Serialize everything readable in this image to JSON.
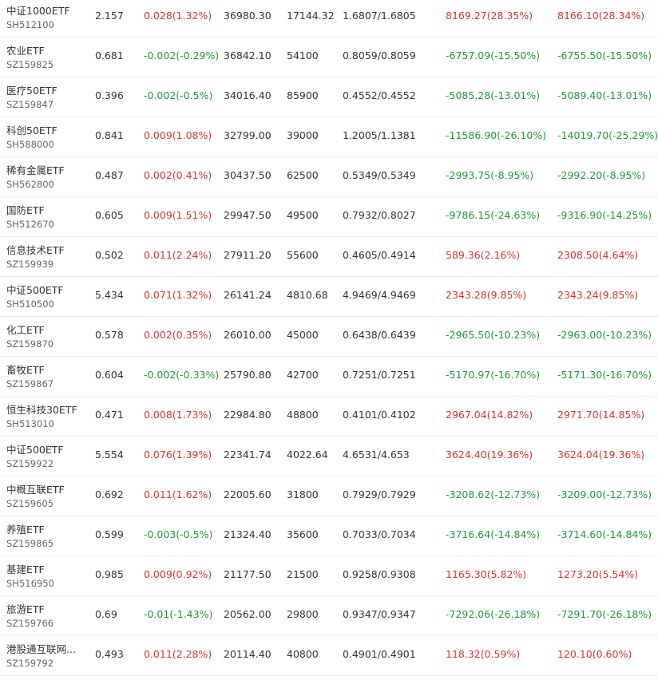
{
  "colors": {
    "up": "#e0312f",
    "down": "#1a9a3a",
    "text": "#333333",
    "subtext": "#666666",
    "divider": "#ececec"
  },
  "rows": [
    {
      "name": "中证1000ETF",
      "code": "SH512100",
      "price": "2.157",
      "change": "0.028(1.32%)",
      "change_dir": "up",
      "amount": "36980.30",
      "volume": "17144.32",
      "bid_ask": "1.6807/1.6805",
      "pl1": "8169.27(28.35%)",
      "pl1_dir": "up",
      "pl2": "8166.10(28.34%)",
      "pl2_dir": "up"
    },
    {
      "name": "农业ETF",
      "code": "SZ159825",
      "price": "0.681",
      "change": "-0.002(-0.29%)",
      "change_dir": "down",
      "amount": "36842.10",
      "volume": "54100",
      "bid_ask": "0.8059/0.8059",
      "pl1": "-6757.09(-15.50%)",
      "pl1_dir": "down",
      "pl2": "-6755.50(-15.50%)",
      "pl2_dir": "down"
    },
    {
      "name": "医疗50ETF",
      "code": "SZ159847",
      "price": "0.396",
      "change": "-0.002(-0.5%)",
      "change_dir": "down",
      "amount": "34016.40",
      "volume": "85900",
      "bid_ask": "0.4552/0.4552",
      "pl1": "-5085.28(-13.01%)",
      "pl1_dir": "down",
      "pl2": "-5089.40(-13.01%)",
      "pl2_dir": "down"
    },
    {
      "name": "科创50ETF",
      "code": "SH588000",
      "price": "0.841",
      "change": "0.009(1.08%)",
      "change_dir": "up",
      "amount": "32799.00",
      "volume": "39000",
      "bid_ask": "1.2005/1.1381",
      "pl1": "-11586.90(-26.10%)",
      "pl1_dir": "down",
      "pl2": "-14019.70(-25.29%)",
      "pl2_dir": "down"
    },
    {
      "name": "稀有金属ETF",
      "code": "SH562800",
      "price": "0.487",
      "change": "0.002(0.41%)",
      "change_dir": "up",
      "amount": "30437.50",
      "volume": "62500",
      "bid_ask": "0.5349/0.5349",
      "pl1": "-2993.75(-8.95%)",
      "pl1_dir": "down",
      "pl2": "-2992.20(-8.95%)",
      "pl2_dir": "down"
    },
    {
      "name": "国防ETF",
      "code": "SH512670",
      "price": "0.605",
      "change": "0.009(1.51%)",
      "change_dir": "up",
      "amount": "29947.50",
      "volume": "49500",
      "bid_ask": "0.7932/0.8027",
      "pl1": "-9786.15(-24.63%)",
      "pl1_dir": "down",
      "pl2": "-9316.90(-14.25%)",
      "pl2_dir": "down"
    },
    {
      "name": "信息技术ETF",
      "code": "SZ159939",
      "price": "0.502",
      "change": "0.011(2.24%)",
      "change_dir": "up",
      "amount": "27911.20",
      "volume": "55600",
      "bid_ask": "0.4605/0.4914",
      "pl1": "589.36(2.16%)",
      "pl1_dir": "up",
      "pl2": "2308.50(4.64%)",
      "pl2_dir": "up"
    },
    {
      "name": "中证500ETF",
      "code": "SH510500",
      "price": "5.434",
      "change": "0.071(1.32%)",
      "change_dir": "up",
      "amount": "26141.24",
      "volume": "4810.68",
      "bid_ask": "4.9469/4.9469",
      "pl1": "2343.28(9.85%)",
      "pl1_dir": "up",
      "pl2": "2343.24(9.85%)",
      "pl2_dir": "up"
    },
    {
      "name": "化工ETF",
      "code": "SZ159870",
      "price": "0.578",
      "change": "0.002(0.35%)",
      "change_dir": "up",
      "amount": "26010.00",
      "volume": "45000",
      "bid_ask": "0.6438/0.6439",
      "pl1": "-2965.50(-10.23%)",
      "pl1_dir": "down",
      "pl2": "-2963.00(-10.23%)",
      "pl2_dir": "down"
    },
    {
      "name": "畜牧ETF",
      "code": "SZ159867",
      "price": "0.604",
      "change": "-0.002(-0.33%)",
      "change_dir": "down",
      "amount": "25790.80",
      "volume": "42700",
      "bid_ask": "0.7251/0.7251",
      "pl1": "-5170.97(-16.70%)",
      "pl1_dir": "down",
      "pl2": "-5171.30(-16.70%)",
      "pl2_dir": "down"
    },
    {
      "name": "恒生科技30ETF",
      "code": "SH513010",
      "price": "0.471",
      "change": "0.008(1.73%)",
      "change_dir": "up",
      "amount": "22984.80",
      "volume": "48800",
      "bid_ask": "0.4101/0.4102",
      "pl1": "2967.04(14.82%)",
      "pl1_dir": "up",
      "pl2": "2971.70(14.85%)",
      "pl2_dir": "up"
    },
    {
      "name": "中证500ETF",
      "code": "SZ159922",
      "price": "5.554",
      "change": "0.076(1.39%)",
      "change_dir": "up",
      "amount": "22341.74",
      "volume": "4022.64",
      "bid_ask": "4.6531/4.653",
      "pl1": "3624.40(19.36%)",
      "pl1_dir": "up",
      "pl2": "3624.04(19.36%)",
      "pl2_dir": "up"
    },
    {
      "name": "中概互联ETF",
      "code": "SZ159605",
      "price": "0.692",
      "change": "0.011(1.62%)",
      "change_dir": "up",
      "amount": "22005.60",
      "volume": "31800",
      "bid_ask": "0.7929/0.7929",
      "pl1": "-3208.62(-12.73%)",
      "pl1_dir": "down",
      "pl2": "-3209.00(-12.73%)",
      "pl2_dir": "down"
    },
    {
      "name": "养殖ETF",
      "code": "SZ159865",
      "price": "0.599",
      "change": "-0.003(-0.5%)",
      "change_dir": "down",
      "amount": "21324.40",
      "volume": "35600",
      "bid_ask": "0.7033/0.7034",
      "pl1": "-3716.64(-14.84%)",
      "pl1_dir": "down",
      "pl2": "-3714.60(-14.84%)",
      "pl2_dir": "down"
    },
    {
      "name": "基建ETF",
      "code": "SH516950",
      "price": "0.985",
      "change": "0.009(0.92%)",
      "change_dir": "up",
      "amount": "21177.50",
      "volume": "21500",
      "bid_ask": "0.9258/0.9308",
      "pl1": "1165.30(5.82%)",
      "pl1_dir": "up",
      "pl2": "1273.20(5.54%)",
      "pl2_dir": "up"
    },
    {
      "name": "旅游ETF",
      "code": "SZ159766",
      "price": "0.69",
      "change": "-0.01(-1.43%)",
      "change_dir": "down",
      "amount": "20562.00",
      "volume": "29800",
      "bid_ask": "0.9347/0.9347",
      "pl1": "-7292.06(-26.18%)",
      "pl1_dir": "down",
      "pl2": "-7291.70(-26.18%)",
      "pl2_dir": "down"
    },
    {
      "name": "港股通互联网...",
      "code": "SZ159792",
      "price": "0.493",
      "change": "0.011(2.28%)",
      "change_dir": "up",
      "amount": "20114.40",
      "volume": "40800",
      "bid_ask": "0.4901/0.4901",
      "pl1": "118.32(0.59%)",
      "pl1_dir": "up",
      "pl2": "120.10(0.60%)",
      "pl2_dir": "up"
    }
  ]
}
